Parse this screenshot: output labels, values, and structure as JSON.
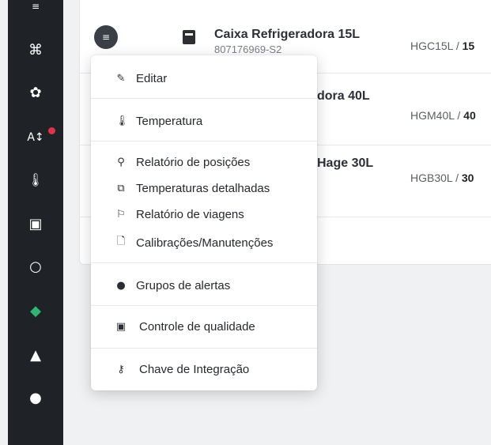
{
  "sidebar": {
    "icons": [
      "analytics-icon",
      "command-icon",
      "flower-icon",
      "sort-icon",
      "thermometer-icon",
      "box-icon",
      "circle-icon",
      "diamond-icon",
      "warning-icon",
      "user-icon"
    ],
    "glyphs": [
      "≡",
      "⌘",
      "✿",
      "A↕",
      "🌡",
      "▣",
      "○",
      "◆",
      "▲",
      "●"
    ]
  },
  "table": {
    "rows": [
      {
        "name": "Caixa Refrigeradora 15L",
        "id": "807176969-S2",
        "model_prefix": "HGC15L / ",
        "model_bold": "15"
      },
      {
        "name": "dora 40L",
        "id": "",
        "model_prefix": "HGM40L / ",
        "model_bold": "40"
      },
      {
        "name": "Hage 30L",
        "id": "",
        "model_prefix": "HGB30L / ",
        "model_bold": "30"
      }
    ]
  },
  "menu": {
    "items": [
      {
        "icon": "edit-icon",
        "glyph": "✎",
        "label": "Editar"
      },
      {
        "icon": "thermometer-icon",
        "glyph": "🌡",
        "label": "Temperatura"
      },
      {
        "icon": "position-report-icon",
        "glyph": "⚲",
        "label": "Relatório de posições"
      },
      {
        "icon": "detailed-temps-icon",
        "glyph": "⧉",
        "label": "Temperaturas detalhadas"
      },
      {
        "icon": "trip-report-icon",
        "glyph": "⚐",
        "label": "Relatório de viagens"
      },
      {
        "icon": "calibration-icon",
        "glyph": "🗋",
        "label": "Calibrações/Manutenções"
      },
      {
        "icon": "alert-groups-icon",
        "glyph": "●",
        "label": "Grupos de alertas"
      },
      {
        "icon": "quality-control-icon",
        "glyph": "▣",
        "label": "Controle de qualidade"
      },
      {
        "icon": "integration-key-icon",
        "glyph": "⚷",
        "label": "Chave de Integração"
      }
    ]
  }
}
